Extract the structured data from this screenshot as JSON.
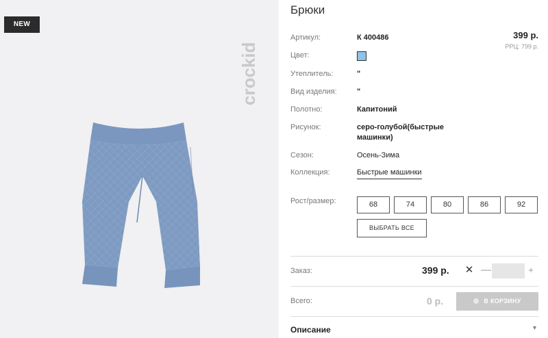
{
  "badge": "NEW",
  "brand": "crockid",
  "title": "Брюки",
  "price": {
    "main": "399 р.",
    "rrc": "РРЦ: 799 р."
  },
  "specs": {
    "article_label": "Артикул:",
    "article_value": "К 400486",
    "color_label": "Цвет:",
    "color_hex": "#8ec3ea",
    "insulation_label": "Утеплитель:",
    "insulation_value": "\"",
    "type_label": "Вид изделия:",
    "type_value": "\"",
    "fabric_label": "Полотно:",
    "fabric_value": "Капитоний",
    "pattern_label": "Рисунок:",
    "pattern_line1": "серо-голубой(быстрые",
    "pattern_line2": "машинки)",
    "season_label": "Сезон:",
    "season_value": "Осень-Зима",
    "collection_label": "Коллекция:",
    "collection_value": "Быстрые машинки"
  },
  "sizes": {
    "label": "Рост/размер:",
    "options": [
      "68",
      "74",
      "80",
      "86",
      "92"
    ],
    "select_all": "ВЫБРАТЬ ВСЕ"
  },
  "order": {
    "label": "Заказ:",
    "price": "399 р.",
    "close": "✕",
    "minus": "—",
    "quantity": "",
    "plus": "+"
  },
  "total": {
    "label": "Всего:",
    "value": "0 р.",
    "cart_button": "В КОРЗИНУ"
  },
  "description": {
    "label": "Описание",
    "chevron": "▼"
  }
}
